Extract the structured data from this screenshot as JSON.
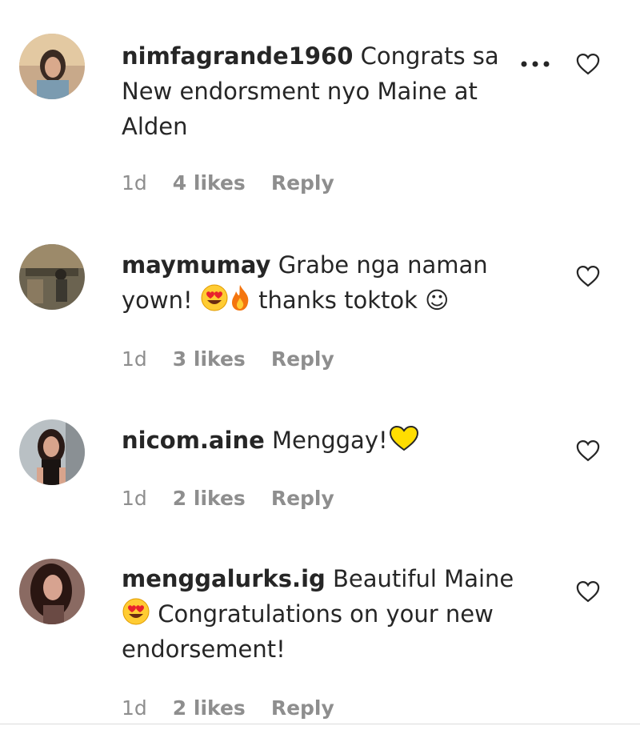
{
  "comments": [
    {
      "username": "nimfagrande1960",
      "text_lines": [
        "Congrats sa",
        "New endorsment nyo Maine at",
        "Alden"
      ],
      "time": "1d",
      "likes": "4 likes",
      "reply": "Reply"
    },
    {
      "username": "maymumay",
      "text_lines": [
        "Grabe nga naman",
        "yown!",
        "thanks toktok ☺"
      ],
      "time": "1d",
      "likes": "3 likes",
      "reply": "Reply"
    },
    {
      "username": "nicom.aine",
      "text_lines": [
        "Menggay!"
      ],
      "time": "1d",
      "likes": "2 likes",
      "reply": "Reply"
    },
    {
      "username": "menggalurks.ig",
      "text_lines": [
        "Beautiful Maine",
        "Congratulations on your new",
        "endorsement!"
      ],
      "time": "1d",
      "likes": "2 likes",
      "reply": "Reply"
    }
  ],
  "icons": {
    "heart": "heart-outline-icon",
    "more": "more-options-icon",
    "heart_eyes": "heart-eyes-emoji",
    "fire": "fire-emoji",
    "yellow_heart": "yellow-heart-emoji"
  },
  "colors": {
    "text": "#262626",
    "meta": "#8e8e8e",
    "yellow_heart": "#ffdd00"
  }
}
